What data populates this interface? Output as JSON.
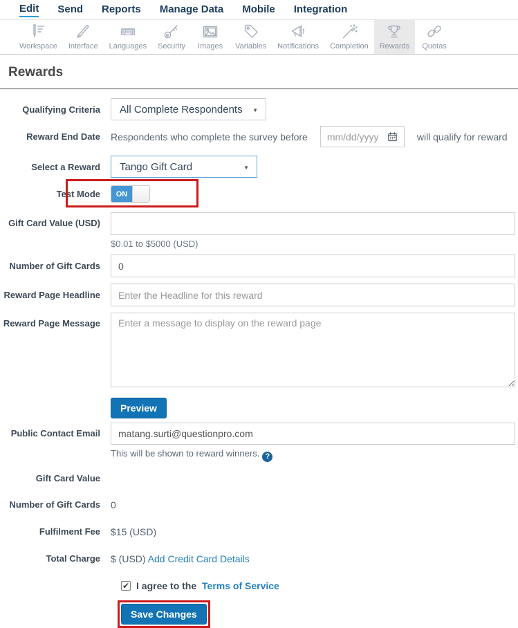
{
  "nav": {
    "items": [
      {
        "label": "Edit",
        "active": true
      },
      {
        "label": "Send",
        "active": false
      },
      {
        "label": "Reports",
        "active": false
      },
      {
        "label": "Manage Data",
        "active": false
      },
      {
        "label": "Mobile",
        "active": false
      },
      {
        "label": "Integration",
        "active": false
      }
    ]
  },
  "toolbar": {
    "tabs": [
      {
        "label": "Workspace",
        "icon": "workspace-icon",
        "selected": false
      },
      {
        "label": "Interface",
        "icon": "interface-icon",
        "selected": false
      },
      {
        "label": "Languages",
        "icon": "languages-icon",
        "selected": false
      },
      {
        "label": "Security",
        "icon": "security-icon",
        "selected": false
      },
      {
        "label": "Images",
        "icon": "images-icon",
        "selected": false
      },
      {
        "label": "Variables",
        "icon": "variables-icon",
        "selected": false
      },
      {
        "label": "Notifications",
        "icon": "notifications-icon",
        "selected": false
      },
      {
        "label": "Completion",
        "icon": "completion-icon",
        "selected": false
      },
      {
        "label": "Rewards",
        "icon": "rewards-icon",
        "selected": true
      },
      {
        "label": "Quotas",
        "icon": "quotas-icon",
        "selected": false
      }
    ]
  },
  "page": {
    "title": "Rewards"
  },
  "form": {
    "qualifying_criteria": {
      "label": "Qualifying Criteria",
      "value": "All Complete Respondents"
    },
    "reward_end_date": {
      "label": "Reward End Date",
      "prefix": "Respondents who complete the survey before",
      "placeholder": "mm/dd/yyyy",
      "suffix": "will qualify for reward"
    },
    "select_reward": {
      "label": "Select a Reward",
      "value": "Tango Gift Card"
    },
    "test_mode": {
      "label": "Test Mode",
      "state": "ON"
    },
    "gift_card_value": {
      "label": "Gift Card Value (USD)",
      "value": "",
      "helper": "$0.01 to $5000 (USD)"
    },
    "number_of_gift_cards": {
      "label": "Number of Gift Cards",
      "value": "0"
    },
    "reward_page_headline": {
      "label": "Reward Page Headline",
      "placeholder": "Enter the Headline for this reward"
    },
    "reward_page_message": {
      "label": "Reward Page Message",
      "placeholder": "Enter a message to display on the reward page"
    },
    "preview_button": "Preview",
    "public_contact_email": {
      "label": "Public Contact Email",
      "value": "matang.surti@questionpro.com",
      "helper": "This will be shown to reward winners.",
      "help_glyph": "?"
    },
    "summary": {
      "gift_card_value": {
        "label": "Gift Card Value",
        "value": ""
      },
      "number_of_gift_cards": {
        "label": "Number of Gift Cards",
        "value": "0"
      },
      "fulfilment_fee": {
        "label": "Fulfilment Fee",
        "value": "$15 (USD)"
      },
      "total_charge": {
        "label": "Total Charge",
        "value": "$ (USD)",
        "link": "Add Credit Card Details"
      }
    },
    "agreement": {
      "text": "I agree to the",
      "link": "Terms of Service",
      "checked": true,
      "checkmark": "✔"
    },
    "save_button": "Save Changes"
  },
  "colors": {
    "accent_blue": "#1273b5",
    "link_blue": "#2380c0",
    "toggle_blue": "#4596d3",
    "highlight_red": "#cc1b1b",
    "nav_navy": "#1c3c5e",
    "selected_tab_bg": "#e9e9e9"
  }
}
